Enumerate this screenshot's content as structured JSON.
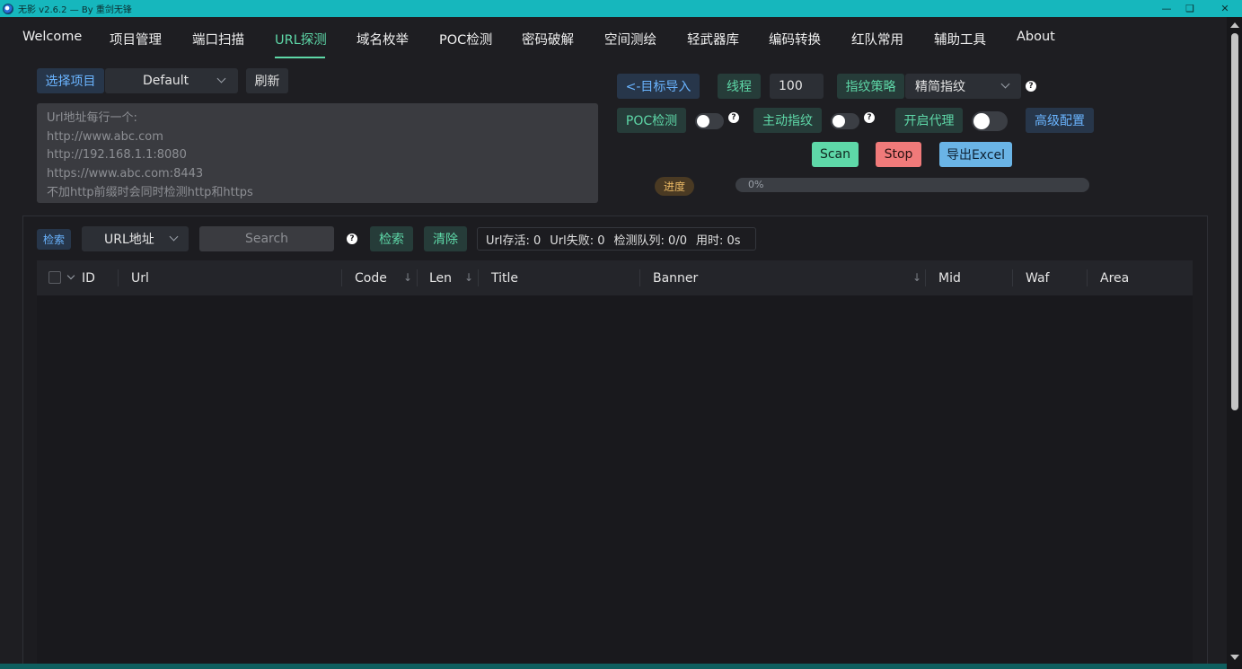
{
  "window": {
    "title": "无影 v2.6.2 — By 重剑无锋"
  },
  "nav": {
    "items": [
      "Welcome",
      "项目管理",
      "端口扫描",
      "URL探测",
      "域名枚举",
      "POC检测",
      "密码破解",
      "空间测绘",
      "轻武器库",
      "编码转换",
      "红队常用",
      "辅助工具",
      "About"
    ],
    "active": "URL探测"
  },
  "project": {
    "select_label": "选择项目",
    "selected": "Default",
    "refresh_label": "刷新"
  },
  "targets": {
    "placeholder": "Url地址每行一个:\nhttp://www.abc.com\nhttp://192.168.1.1:8080\nhttps://www.abc.com:8443\n不加http前缀时会同时检测http和https"
  },
  "controls": {
    "import_label": "<-目标导入",
    "threads_label": "线程",
    "threads_value": "100",
    "fingerprint_strategy_label": "指纹策略",
    "fingerprint_strategy_value": "精简指纹",
    "poc_label": "POC检测",
    "poc_enabled": false,
    "active_fp_label": "主动指纹",
    "active_fp_enabled": false,
    "proxy_label": "开启代理",
    "proxy_enabled": false,
    "advanced_label": "高级配置",
    "scan_label": "Scan",
    "stop_label": "Stop",
    "export_label": "导出Excel",
    "help_glyph": "?"
  },
  "progress": {
    "label": "进度",
    "value": 0,
    "text": "0%"
  },
  "filter": {
    "tag_label": "检索",
    "field_value": "URL地址",
    "search_placeholder": "Search",
    "search_button": "检索",
    "clear_button": "清除"
  },
  "stats": {
    "alive": "Url存活: 0",
    "failed": "Url失败: 0",
    "queue": "检测队列: 0/0",
    "elapsed": "用时: 0s"
  },
  "table": {
    "columns": [
      "ID",
      "Url",
      "Code",
      "Len",
      "Title",
      "Banner",
      "Mid",
      "Waf",
      "Area"
    ],
    "sort_glyph": "↓",
    "rows": []
  },
  "colors": {
    "accent_teal": "#5ed8a8",
    "accent_blue": "#6ab4ff",
    "titlebar": "#16b7bd",
    "scan_button": "#5ed8a8",
    "stop_button": "#f07a7a",
    "export_button": "#6ab4e6"
  }
}
